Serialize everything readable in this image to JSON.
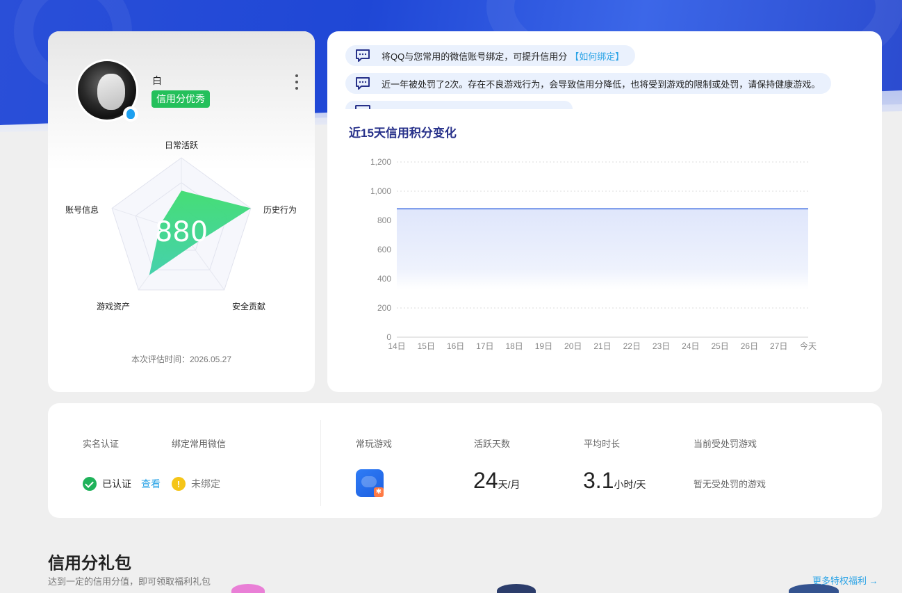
{
  "profile": {
    "username": "白",
    "credit_level": "信用分优秀",
    "score": "880",
    "eval_time": "本次评估时间：2026.05.27",
    "radar": {
      "labels": [
        "日常活跃",
        "历史行为",
        "安全贡献",
        "游戏资产",
        "账号信息"
      ],
      "values": [
        0.55,
        1.0,
        0.25,
        0.75,
        0.3
      ]
    }
  },
  "notices": [
    {
      "text": "将QQ与您常用的微信账号绑定，可提升信用分",
      "link": "【如何绑定】"
    },
    {
      "text": "近一年被处罚了2次。存在不良游戏行为，会导致信用分降低，也将受到游戏的限制或处罚，请保持健康游戏。",
      "link": ""
    }
  ],
  "chart_title": "近15天信用积分变化",
  "chart_data": {
    "type": "area",
    "title": "近15天信用积分变化",
    "categories": [
      "14日",
      "15日",
      "16日",
      "17日",
      "18日",
      "19日",
      "20日",
      "21日",
      "22日",
      "23日",
      "24日",
      "25日",
      "26日",
      "27日",
      "今天"
    ],
    "values": [
      880,
      880,
      880,
      880,
      880,
      880,
      880,
      880,
      880,
      880,
      880,
      880,
      880,
      880,
      880
    ],
    "yticks": [
      "0",
      "200",
      "400",
      "600",
      "800",
      "1,000",
      "1,200"
    ],
    "ylim": [
      0,
      1200
    ],
    "grid": true,
    "color": "#6b8fe8"
  },
  "stats": {
    "realname_label": "实名认证",
    "wechat_label": "绑定常用微信",
    "verified_text": "已认证",
    "view_text": "查看",
    "unbound_text": "未绑定",
    "games_label": "常玩游戏",
    "active_label": "活跃天数",
    "active_value": "24",
    "active_unit": "天/月",
    "avg_label": "平均时长",
    "avg_value": "3.1",
    "avg_unit": "小时/天",
    "penalty_label": "当前受处罚游戏",
    "penalty_value": "暂无受处罚的游戏"
  },
  "gift": {
    "title": "信用分礼包",
    "subtitle": "达到一定的信用分值，即可领取福利礼包",
    "more": "更多特权福利 →"
  }
}
